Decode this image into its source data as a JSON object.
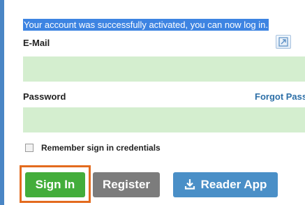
{
  "notice": {
    "success_text": "Your account was successfully activated, you can now log in."
  },
  "form": {
    "email_label": "E-Mail",
    "email_value": "",
    "password_label": "Password",
    "password_value": "",
    "forgot_link": "Forgot Passw",
    "remember_label": "Remember sign in credentials",
    "remember_checked": false
  },
  "buttons": {
    "signin_label": "Sign In",
    "register_label": "Register",
    "reader_label": "Reader App"
  },
  "icons": {
    "expand": "expand-icon",
    "download": "download-icon"
  },
  "colors": {
    "field_bg": "#d4eecf",
    "signin_bg": "#43ad3b",
    "register_bg": "#7c7c7c",
    "reader_bg": "#4a8fc7",
    "highlight": "#e36b1e",
    "selection": "#3d84e2",
    "link": "#2d6fa7"
  }
}
